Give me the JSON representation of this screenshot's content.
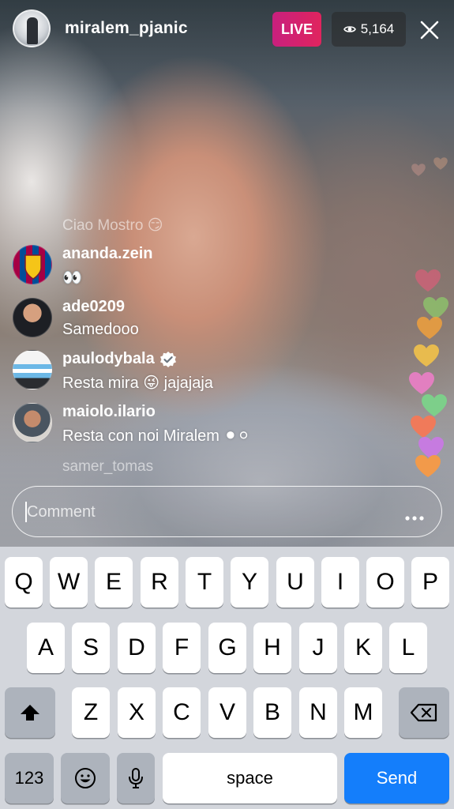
{
  "header": {
    "username": "miralem_pjanic",
    "live_label": "LIVE",
    "viewer_count": "5,164"
  },
  "comments": {
    "faded_top": "Ciao Mostro 😏",
    "items": [
      {
        "user": "ananda.zein",
        "text": "👀",
        "verified": false
      },
      {
        "user": "ade0209",
        "text": "Samedooo",
        "verified": false
      },
      {
        "user": "paulodybala",
        "text": "Resta mira 😜 jajajaja",
        "verified": true
      },
      {
        "user": "maiolo.ilario",
        "text": "Resta con noi Miralem ⚫⚪",
        "verified": false
      }
    ],
    "faded_bottom": "samer_tomas"
  },
  "comment_input": {
    "placeholder": "Comment"
  },
  "keyboard": {
    "row1": [
      "Q",
      "W",
      "E",
      "R",
      "T",
      "Y",
      "U",
      "I",
      "O",
      "P"
    ],
    "row2": [
      "A",
      "S",
      "D",
      "F",
      "G",
      "H",
      "J",
      "K",
      "L"
    ],
    "row3": [
      "Z",
      "X",
      "C",
      "V",
      "B",
      "N",
      "M"
    ],
    "numbers_label": "123",
    "space_label": "space",
    "send_label": "Send"
  },
  "icons": {
    "eye": "eye-icon",
    "close": "close-icon",
    "verified": "verified-badge-icon",
    "more": "more-options-icon",
    "shift": "shift-icon",
    "backspace": "backspace-icon",
    "emoji": "emoji-icon",
    "mic": "microphone-icon"
  },
  "colors": {
    "live_badge": "#e0245e",
    "send_button": "#147efb",
    "keyboard_bg": "#d3d6dc"
  }
}
